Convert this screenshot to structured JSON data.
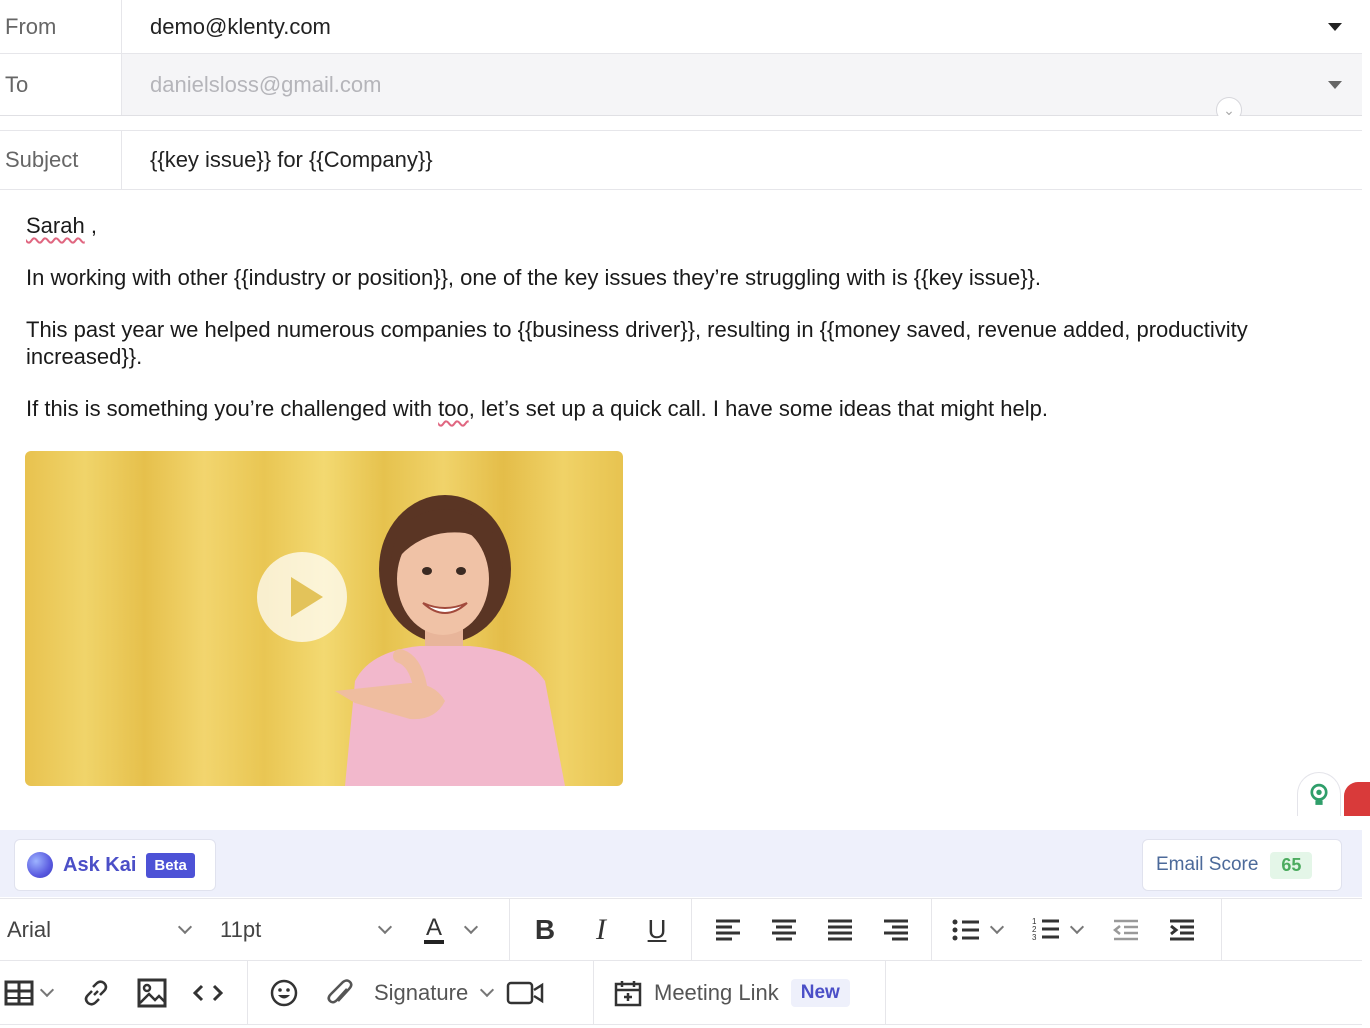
{
  "header": {
    "from_label": "From",
    "from_value": "demo@klenty.com",
    "to_label": "To",
    "to_value": "danielsloss@gmail.com",
    "subject_label": "Subject",
    "subject_value": "{{key issue}} for {{Company}}"
  },
  "body": {
    "greeting": "Sarah",
    "greeting_suffix": " ,",
    "p1": "In working with other {{industry or position}}, one of the key issues they’re struggling with is {{key issue}}.",
    "p2": "This past year we helped numerous companies to {{business driver}}, resulting in {{money saved, revenue added, productivity increased}}.",
    "p3_before": "If this is something you’re challenged with ",
    "p3_flag": "too",
    "p3_after": ", let’s set up a quick call. I have some ideas that might help."
  },
  "kai": {
    "ask_label": "Ask Kai",
    "beta_label": "Beta",
    "score_label": "Email Score",
    "score_value": "65"
  },
  "toolbar": {
    "font": "Arial",
    "size": "11pt",
    "color_letter": "A",
    "bold": "B",
    "italic": "I",
    "underline": "U",
    "signature": "Signature",
    "meeting_link": "Meeting Link",
    "new_badge": "New"
  },
  "colors": {
    "accent": "#4b4fc7",
    "score_green": "#4cab5f",
    "spell_underline": "#e06680"
  },
  "icons": [
    "play-icon",
    "bulb-icon",
    "kai-logo-icon",
    "text-color-icon",
    "align-left-icon",
    "align-center-icon",
    "align-justify-icon",
    "align-right-icon",
    "bullet-list-icon",
    "numbered-list-icon",
    "outdent-icon",
    "indent-icon",
    "table-icon",
    "link-icon",
    "image-icon",
    "code-icon",
    "emoji-icon",
    "attachment-icon",
    "video-icon",
    "calendar-icon"
  ]
}
